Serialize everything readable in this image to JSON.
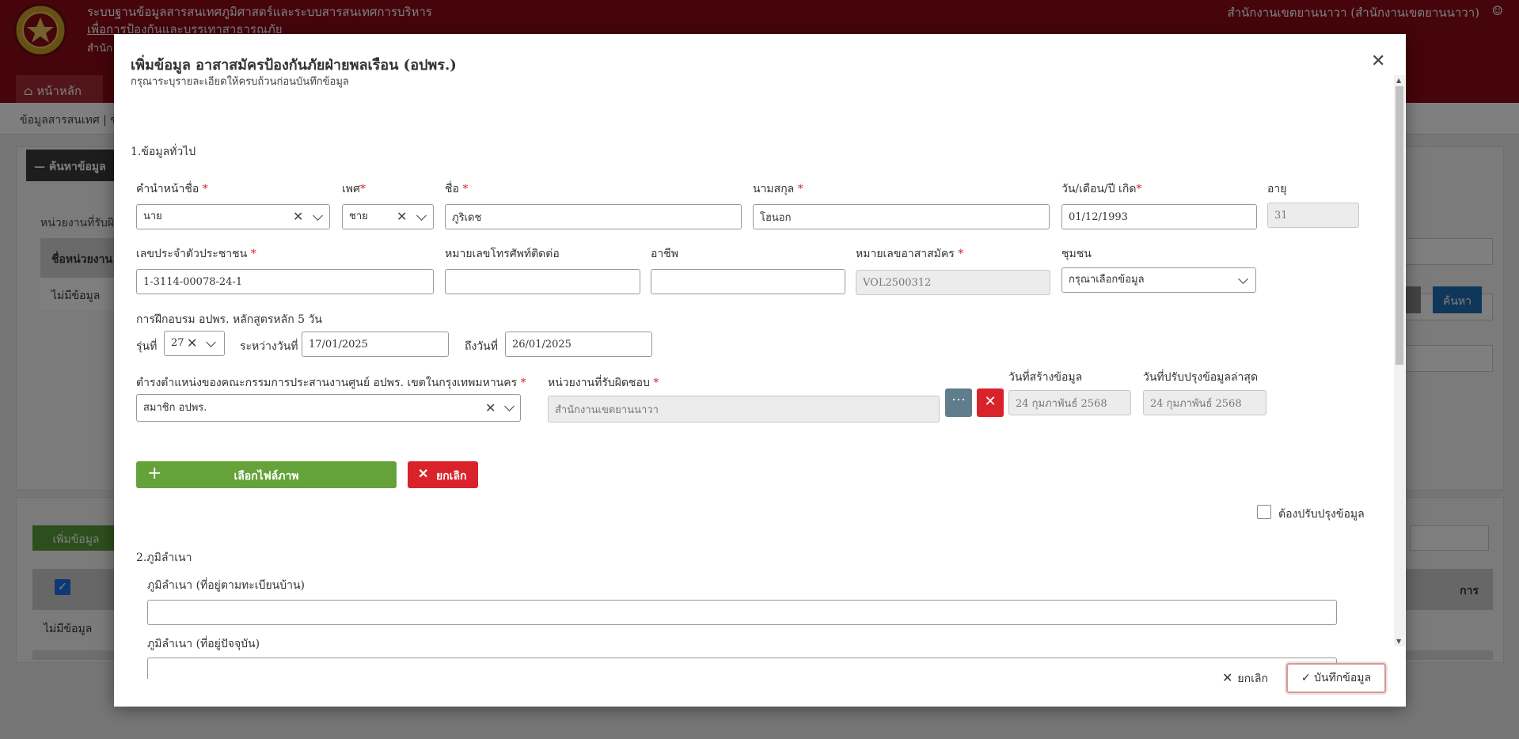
{
  "background": {
    "system_title_line1": "ระบบฐานข้อมูลสารสนเทศภูมิศาสตร์และระบบสารสนเทศการบริหาร",
    "system_title_line2": "เพื่อการป้องกันและบรรเทาสาธารณภัย",
    "system_subtitle": "สำนัก",
    "user_label": "สำนักงานเขตยานนาวา (สำนักงานเขตยานนาวา)",
    "nav_home": "หน้าหลัก",
    "breadcrumb": "ข้อมูลสารสนเทศ | ข้อ",
    "search_toggle": "ค้นหาข้อมูล",
    "unit_label": "หน่วยงานที่รับผิด",
    "table_head": "ชื่อหน่วยงาน",
    "table_nodata": "ไม่มีข้อมูล",
    "search_button": "ค้นหา",
    "add_button": "เพิ่มข้อมูล",
    "list_nodata": "ไม่มีข้อมูล",
    "list_head_right": "การ"
  },
  "modal": {
    "title": "เพิ่มข้อมูล อาสาสมัครป้องกันภัยฝ่ายพลเรือน (อปพร.)",
    "subtitle": "กรุณาระบุรายละเอียดให้ครบถ้วนก่อนบันทึกข้อมูล",
    "section1": "1.ข้อมูลทั่วไป",
    "section2": "2.ภูมิลำเนา",
    "fields": {
      "prefix": {
        "label": "คำนำหน้าชื่อ",
        "value": "นาย"
      },
      "gender": {
        "label": "เพศ",
        "value": "ชาย"
      },
      "first_name": {
        "label": "ชื่อ",
        "value": "ภูริเดช"
      },
      "last_name": {
        "label": "นามสกุล",
        "value": "โฮนอก"
      },
      "birth_date": {
        "label": "วัน/เดือน/ปี เกิด",
        "value": "01/12/1993"
      },
      "age": {
        "label": "อายุ",
        "value": "31"
      },
      "citizen_id": {
        "label": "เลขประจำตัวประชาชน",
        "value": "1-3114-00078-24-1"
      },
      "phone": {
        "label": "หมายเลขโทรศัพท์ติดต่อ",
        "value": ""
      },
      "occupation": {
        "label": "อาชีพ",
        "value": ""
      },
      "volunteer_no": {
        "label": "หมายเลขอาสาสมัคร",
        "value": "VOL2500312"
      },
      "community": {
        "label": "ชุมชน",
        "value": "กรุณาเลือกข้อมูล"
      },
      "training": {
        "label": "การฝึกอบรม อปพร. หลักสูตรหลัก 5 วัน"
      },
      "batch": {
        "label": "รุ่นที่",
        "value": "27"
      },
      "period_from": {
        "label": "ระหว่างวันที่",
        "value": "17/01/2025"
      },
      "period_to": {
        "label": "ถึงวันที่",
        "value": "26/01/2025"
      },
      "committee_position": {
        "label": "ตำรงตำแหน่งของคณะกรรมการประสานงานศูนย์ อปพร. เขตในกรุงเทพมหานคร",
        "value": "สมาชิก อปพร."
      },
      "responsible_unit": {
        "label": "หน่วยงานที่รับผิดชอบ",
        "value": "สำนักงานเขตยานนาวา"
      },
      "created_date": {
        "label": "วันที่สร้างข้อมูล",
        "value": "24 กุมภาพันธ์ 2568"
      },
      "updated_date": {
        "label": "วันที่ปรับปรุงข้อมูลล่าสุด",
        "value": "24 กุมภาพันธ์ 2568"
      },
      "domicile_registered": {
        "label": "ภูมิลำเนา (ที่อยู่ตามทะเบียนบ้าน)",
        "value": ""
      },
      "domicile_current": {
        "label": "ภูมิลำเนา (ที่อยู่ปัจจุบัน)",
        "value": ""
      }
    },
    "select_image_button": "เลือกไฟล์ภาพ",
    "cancel_image_button": "ยกเลิก",
    "needs_update_label": "ต้องปรับปรุงข้อมูล",
    "footer_cancel": "ยกเลิก",
    "footer_save": "บันทึกข้อมูล",
    "required_mark": "*"
  }
}
